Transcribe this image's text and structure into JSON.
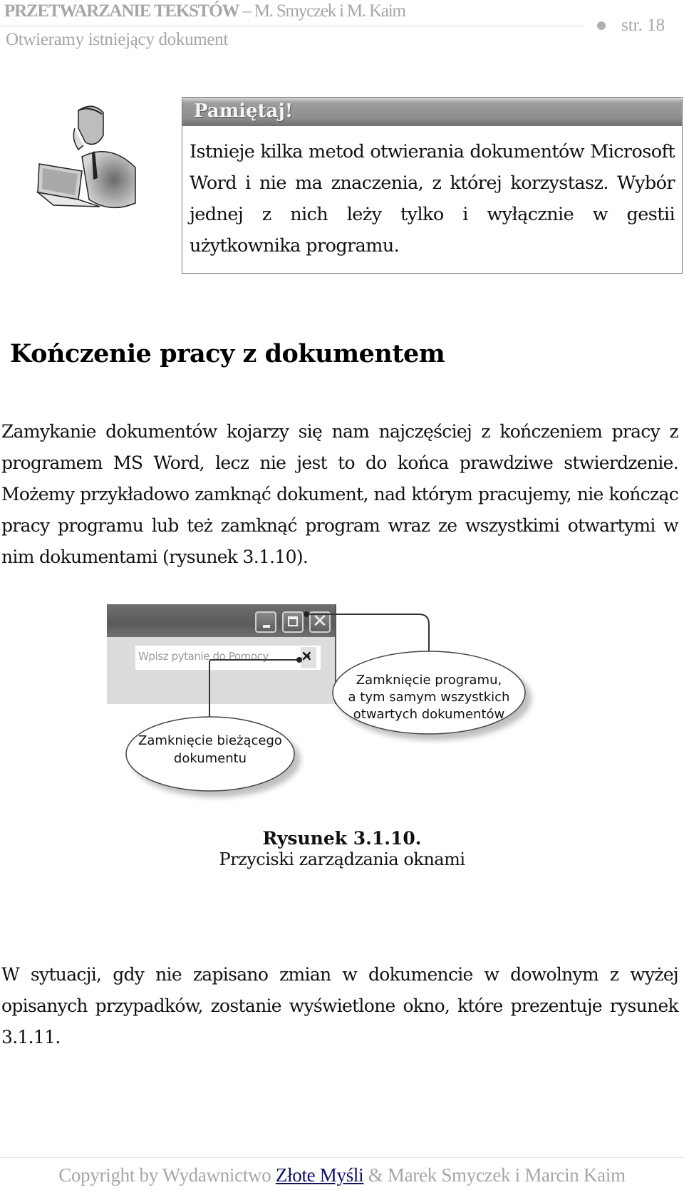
{
  "header": {
    "book_title": "PRZETWARZANIE TEKSTÓW",
    "separator": " – ",
    "authors": "M. Smyczek i M. Kaim",
    "page_label": "str. 18",
    "section": "Otwieramy istniejący dokument"
  },
  "callout": {
    "illustration": "man-with-phone-at-computer-clipart",
    "title": "Pamiętaj!",
    "text": "Istnieje kilka metod otwierania dokumentów Microsoft Word i nie ma znaczenia, z której korzystasz. Wybór jednej z nich leży tylko i wyłącznie w gestii użytkownika programu."
  },
  "section": {
    "heading": "Kończenie pracy z dokumentem",
    "paragraph1": "Zamykanie dokumentów kojarzy się nam najczęściej z kończeniem pracy z programem MS Word, lecz nie jest to do końca prawdziwe stwierdzenie. Możemy przykładowo zamknąć dokument, nad którym pracujemy, nie kończąc pracy programu lub też zamknąć program wraz ze wszystkimi otwartymi w nim dokumentami (rysunek 3.1.10).",
    "paragraph2": "W sytuacji, gdy nie zapisano zmian w dokumencie w dowolnym z wyżej opisanych przypadków, zostanie wyświetlone okno, które prezentuje rysunek 3.1.11."
  },
  "figure": {
    "help_placeholder": "Wpisz pytanie do Pomocy",
    "help_dropdown_icon": "▾",
    "doc_close_glyph": "×",
    "window_buttons": {
      "minimize_icon": "minimize-icon",
      "maximize_icon": "maximize-icon",
      "close_icon": "close-icon",
      "close_glyph": "✕"
    },
    "bubble_document": [
      "Zamknięcie bieżącego",
      "dokumentu"
    ],
    "bubble_program": [
      "Zamknięcie programu,",
      "a tym samym wszystkich",
      "otwartych dokumentów"
    ],
    "caption_number": "Rysunek 3.1.10.",
    "caption_text": "Przyciski zarządzania oknami"
  },
  "footer": {
    "prefix": "Copyright by Wydawnictwo ",
    "link": "Złote Myśli",
    "suffix": " & Marek Smyczek i Marcin Kaim"
  }
}
